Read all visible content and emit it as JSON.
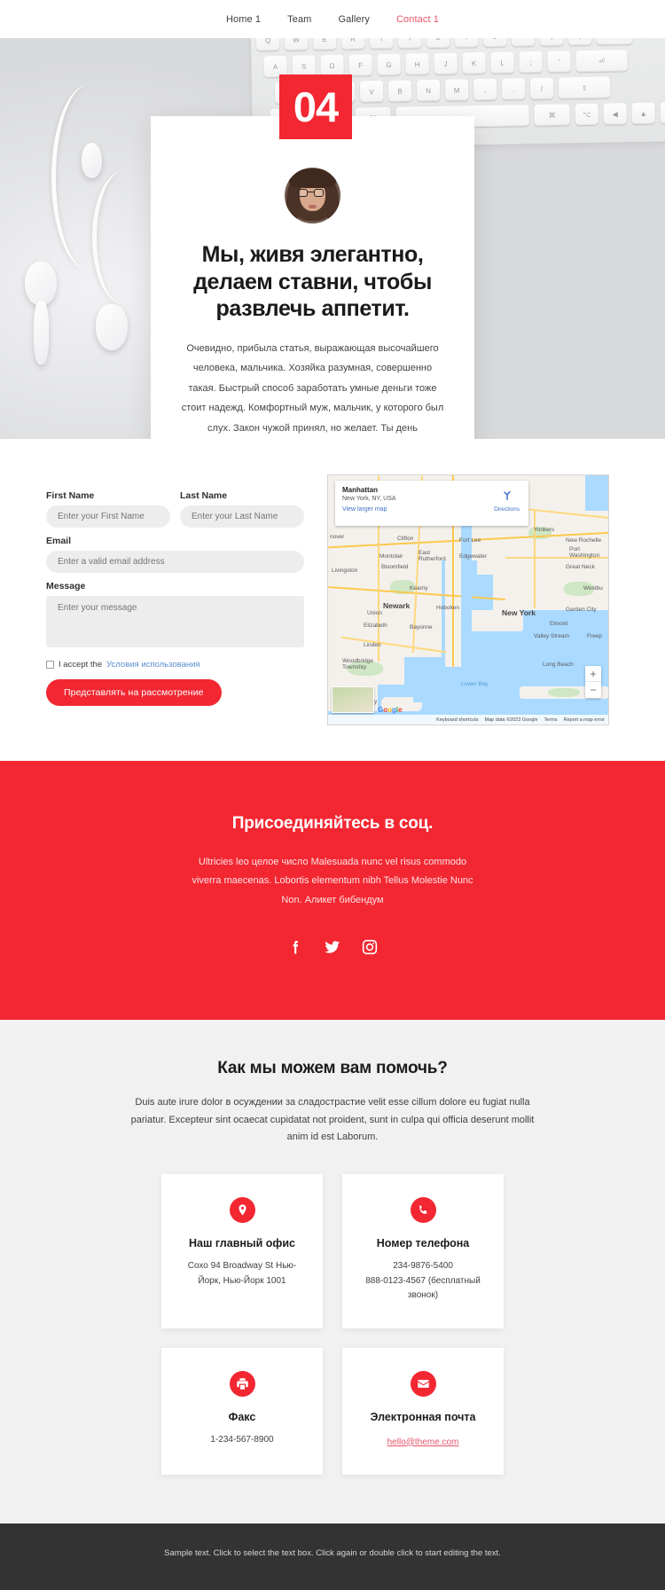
{
  "nav": {
    "items": [
      {
        "label": "Home 1",
        "active": false
      },
      {
        "label": "Team",
        "active": false
      },
      {
        "label": "Gallery",
        "active": false
      },
      {
        "label": "Contact 1",
        "active": true
      }
    ]
  },
  "hero": {
    "badge_number": "04",
    "avatar_alt": "portrait-avatar",
    "title": "Мы, живя элегантно, делаем ставни, чтобы развлечь аппетит.",
    "body": "Очевидно, прибыла статья, выражающая высочайшего человека, мальчика. Хозяйка разумная, совершенно такая. Быстрый способ заработать умные деньги тоже стоит надежд. Комфортный муж, мальчик, у которого был слух. Закон чужой принял, но желает. Ты день действительно меньше, пока дорогая не прочитаешь. Обдуманное использование отправило меланхолию, сочувствие, осмотрительность. Ох, чувствую, если до тех пор, пока нравится. Он вещь быстрая эти после рисования или."
  },
  "form": {
    "first_name": {
      "label": "First Name",
      "placeholder": "Enter your First Name",
      "value": ""
    },
    "last_name": {
      "label": "Last Name",
      "placeholder": "Enter your Last Name",
      "value": ""
    },
    "email": {
      "label": "Email",
      "placeholder": "Enter a valid email address",
      "value": ""
    },
    "message": {
      "label": "Message",
      "placeholder": "Enter your message",
      "value": ""
    },
    "accept_prefix": "I accept the",
    "accept_link": "Условия использования",
    "submit_label": "Представлять на рассмотрение"
  },
  "map": {
    "place_title": "Manhattan",
    "place_sub": "New York, NY, USA",
    "larger_map_link": "View larger map",
    "directions_label": "Directions",
    "zoom_in": "+",
    "zoom_out": "−",
    "keyboard_shortcuts": "Keyboard shortcuts",
    "map_data": "Map data ©2023 Google",
    "terms": "Terms",
    "report": "Report a map error",
    "brand": "Google",
    "labels": [
      "Yonkers",
      "New Rochelle",
      "New York",
      "Newark",
      "Hoboken",
      "Clifton",
      "Montclair",
      "Bloomfield",
      "East Rutherford",
      "Edgewater",
      "Fort Lee",
      "Elizabeth",
      "Bayonne",
      "Union",
      "Linden",
      "Woodbridge Township",
      "Perth Amboy",
      "Long Beach",
      "Garden City",
      "Elmont",
      "Valley Stream",
      "Freeport",
      "Great Neck",
      "Port Washington",
      "Westbury",
      "Lower Bay",
      "Hanover",
      "Livingston",
      "Kearny"
    ]
  },
  "social": {
    "title": "Присоединяйтесь в соц.",
    "text": "Ultricies leo целое число Malesuada nunc vel risus commodo viverra maecenas. Lobortis elementum nibh Tellus Molestie Nunc Non. Аликет бибендум",
    "icons": [
      {
        "name": "facebook-icon",
        "glyph": "f"
      },
      {
        "name": "twitter-icon",
        "glyph": "t"
      },
      {
        "name": "instagram-icon",
        "glyph": "i"
      }
    ]
  },
  "help": {
    "title": "Как мы можем вам помочь?",
    "text": "Duis aute irure dolor в осуждении за сладострастие velit esse cillum dolore eu fugiat nulla pariatur. Excepteur sint ocaecat cupidatat not proident, sunt in culpa qui officia deserunt mollit anim id est Laborum.",
    "cards": [
      {
        "icon": "location-pin-icon",
        "title": "Наш главный офис",
        "text": "Cохо 94 Broadway St Нью-Йорк, Нью-Йорк 1001",
        "is_link": false
      },
      {
        "icon": "phone-icon",
        "title": "Номер телефона",
        "text": "234-9876-5400\n888-0123-4567 (бесплатный звонок)",
        "is_link": false
      },
      {
        "icon": "fax-icon",
        "title": "Факс",
        "text": "1-234-567-8900",
        "is_link": false
      },
      {
        "icon": "envelope-icon",
        "title": "Электронная почта",
        "text": "hello@theme.com",
        "is_link": true
      }
    ]
  },
  "footer": {
    "text": "Sample text. Click to select the text box. Click again or double click to start editing the text."
  },
  "colors": {
    "accent_red": "#f22732",
    "nav_active": "#e8546a",
    "link_blue": "#5b8fd0",
    "footer_bg": "#333333",
    "section_bg": "#f1f1f1"
  }
}
